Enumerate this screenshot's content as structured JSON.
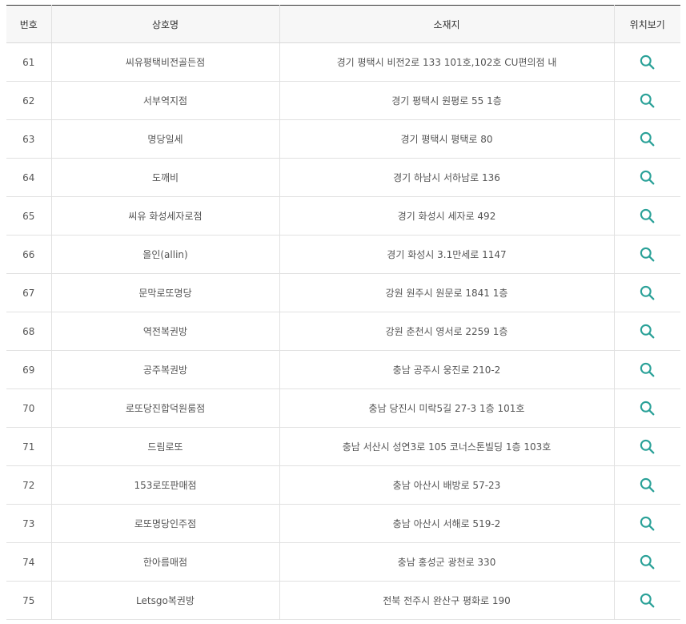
{
  "table": {
    "headers": {
      "no": "번호",
      "name": "상호명",
      "address": "소재지",
      "location": "위치보기"
    },
    "icon": "search-icon",
    "accent_color": "#2aa198",
    "rows": [
      {
        "no": "61",
        "name": "씨유평택비전골든점",
        "address": "경기 평택시 비전2로 133 101호,102호 CU편의점 내"
      },
      {
        "no": "62",
        "name": "서부역지점",
        "address": "경기 평택시 원평로 55 1층"
      },
      {
        "no": "63",
        "name": "명당일세",
        "address": "경기 평택시 평택로 80"
      },
      {
        "no": "64",
        "name": "도깨비",
        "address": "경기 하남시 서하남로 136"
      },
      {
        "no": "65",
        "name": "씨유 화성세자로점",
        "address": "경기 화성시 세자로 492"
      },
      {
        "no": "66",
        "name": "올인(allin)",
        "address": "경기 화성시 3.1만세로 1147"
      },
      {
        "no": "67",
        "name": "문막로또명당",
        "address": "강원 원주시 원문로 1841 1층"
      },
      {
        "no": "68",
        "name": "역전복권방",
        "address": "강원 춘천시 영서로 2259 1층"
      },
      {
        "no": "69",
        "name": "공주복권방",
        "address": "충남 공주시 웅진로 210-2"
      },
      {
        "no": "70",
        "name": "로또당진합덕원룸점",
        "address": "충남 당진시 미락5길 27-3 1층 101호"
      },
      {
        "no": "71",
        "name": "드림로또",
        "address": "충남 서산시 성연3로 105 코너스톤빌딩 1층 103호"
      },
      {
        "no": "72",
        "name": "153로또판매점",
        "address": "충남 아산시 배방로 57-23"
      },
      {
        "no": "73",
        "name": "로또명당인주점",
        "address": "충남 아산시 서해로 519-2"
      },
      {
        "no": "74",
        "name": "한아름매점",
        "address": "충남 홍성군 광천로 330"
      },
      {
        "no": "75",
        "name": "Letsgo복권방",
        "address": "전북 전주시 완산구 평화로 190"
      }
    ]
  }
}
